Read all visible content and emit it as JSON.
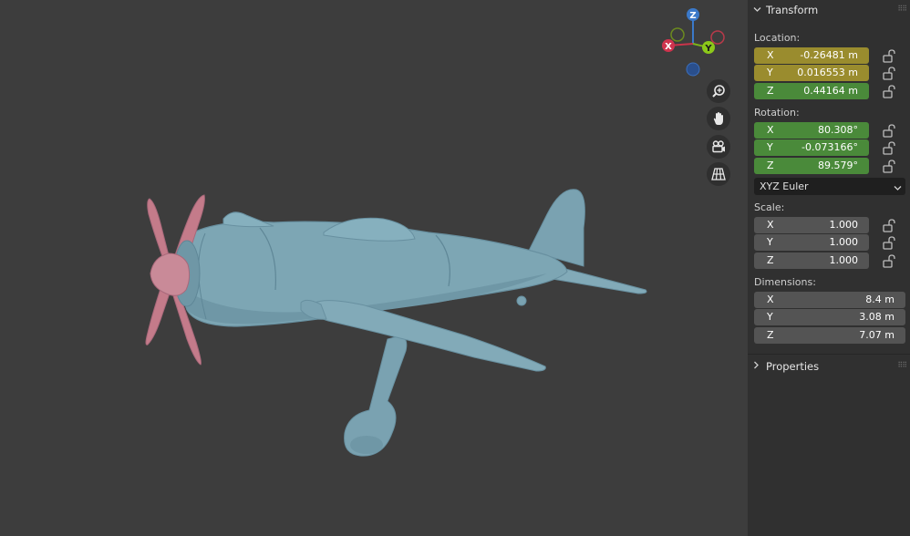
{
  "gizmo": {
    "z_label": "Z",
    "x_label": "X",
    "y_label": "Y"
  },
  "nav_icons": [
    "zoom-icon",
    "pan-hand-icon",
    "camera-icon",
    "grid-icon"
  ],
  "transform": {
    "title": "Transform",
    "location": {
      "label": "Location:",
      "x": "-0.26481 m",
      "y": "0.016553 m",
      "z": "0.44164 m"
    },
    "rotation": {
      "label": "Rotation:",
      "x": "80.308°",
      "y": "-0.073166°",
      "z": "89.579°",
      "mode": "XYZ Euler"
    },
    "scale": {
      "label": "Scale:",
      "x": "1.000",
      "y": "1.000",
      "z": "1.000"
    },
    "dimensions": {
      "label": "Dimensions:",
      "x": "8.4 m",
      "y": "3.08 m",
      "z": "7.07 m"
    }
  },
  "properties": {
    "title": "Properties"
  },
  "axis_letters": {
    "x": "X",
    "y": "Y",
    "z": "Z"
  },
  "colors": {
    "viewport_bg": "#3d3d3d",
    "panel_bg": "#303030",
    "location_field": "#9a8c2e",
    "animated_field": "#4a8a3a",
    "plane_body": "#7da6b4",
    "propeller": "#c47b8a"
  }
}
